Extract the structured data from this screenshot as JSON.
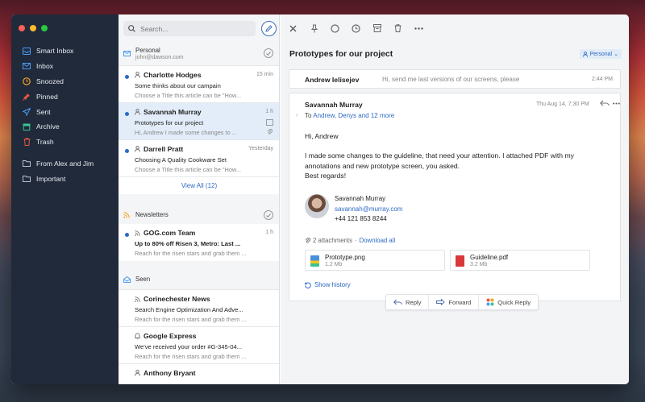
{
  "window": {
    "traffic_lights": [
      "#fd5f57",
      "#febc2e",
      "#28c840"
    ]
  },
  "sidebar": {
    "items": [
      {
        "label": "Smart Inbox",
        "icon": "smart-inbox-icon"
      },
      {
        "label": "Inbox",
        "icon": "inbox-icon"
      },
      {
        "label": "Snoozed",
        "icon": "snooze-clock-icon"
      },
      {
        "label": "Pinned",
        "icon": "pin-icon"
      },
      {
        "label": "Sent",
        "icon": "paper-plane-icon"
      },
      {
        "label": "Archive",
        "icon": "archive-box-icon"
      },
      {
        "label": "Trash",
        "icon": "trash-icon"
      }
    ],
    "folders": [
      {
        "label": "From Alex and Jim",
        "icon": "folder-icon"
      },
      {
        "label": "Important",
        "icon": "folder-icon"
      }
    ]
  },
  "list": {
    "search_placeholder": "Search...",
    "groups": [
      {
        "title": "Personal",
        "subtitle": "john@dawson.com",
        "messages": [
          {
            "from": "Charlotte Hodges",
            "time": "15 min",
            "subject": "Some thinks about our campain",
            "preview": "Choose a Title this article can be \"How...",
            "unread": true,
            "selected": false
          },
          {
            "from": "Savannah Murray",
            "time": "1 h",
            "subject": "Prototypes for our project",
            "preview": "Hi, Andrew I made some changes to ...",
            "unread": true,
            "selected": true
          },
          {
            "from": "Darrell Pratt",
            "time": "Yesterday",
            "subject": "Choosing A Quality Cookware Set",
            "preview": "Choose a Title this article can be \"How...",
            "unread": true,
            "selected": false
          }
        ],
        "view_all": "View All (12)"
      },
      {
        "title": "Newsletters",
        "messages": [
          {
            "from": "GOG.com Team",
            "time": "1 h",
            "subject": "Up to 80% off Risen 3, Metro: Last ...",
            "preview": "Reach for the risen stars and grab them ...",
            "unread": true
          }
        ]
      },
      {
        "title": "Seen",
        "messages": [
          {
            "from": "Corinechester News",
            "time": "",
            "subject": "Search Engine Optimization And Adve...",
            "preview": "Reach for the risen stars and grab them ..."
          },
          {
            "from": "Google Express",
            "time": "",
            "subject": "We've received your order #G-345-04...",
            "preview": "Reach for the risen stars and grab them ..."
          },
          {
            "from": "Anthony Bryant",
            "time": "",
            "subject": "",
            "preview": ""
          }
        ]
      }
    ]
  },
  "reader": {
    "subject": "Prototypes for our project",
    "tag": "Personal",
    "collapsed": {
      "from": "Andrew Ielisejev",
      "preview": "Hi, send me last versions of our screens, please",
      "time": "2:44 PM"
    },
    "message": {
      "from": "Savannah Murray",
      "date": "Thu Aug 14, 7:30 PM",
      "to_prefix": "To",
      "to": "Andrew, Denys and 12 more",
      "greeting": "Hi, Andrew",
      "body": "I made some changes to the guideline, that need your attention. I attached PDF with my annotations and new prototype screen, you asked.",
      "closing": "Best regards!",
      "signature": {
        "name": "Savannah Murray",
        "email": "savannah@murray.com",
        "phone": "+44 121 853 8244"
      },
      "attachments_label": "2 attachments",
      "download_all": "Download all",
      "attachments": [
        {
          "name": "Prototype.png",
          "size": "1.2 Mb",
          "color": "#4a90d9"
        },
        {
          "name": "Guideline.pdf",
          "size": "3.2 Mb",
          "color": "#d9383a"
        }
      ],
      "show_history": "Show history"
    },
    "actions": {
      "reply": "Reply",
      "forward": "Forward",
      "quick_reply": "Quick Reply"
    }
  }
}
